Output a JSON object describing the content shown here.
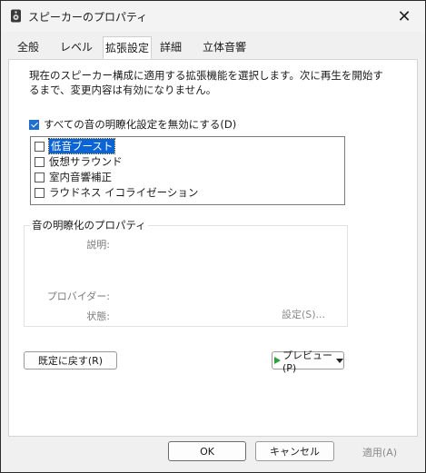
{
  "window": {
    "title": "スピーカーのプロパティ",
    "close_icon": "close-icon"
  },
  "tabs": [
    {
      "label": "全般",
      "active": false
    },
    {
      "label": "レベル",
      "active": false
    },
    {
      "label": "拡張設定",
      "active": true
    },
    {
      "label": "詳細",
      "active": false
    },
    {
      "label": "立体音響",
      "active": false
    }
  ],
  "enhancements": {
    "description": "現在のスピーカー構成に適用する拡張機能を選択します。次に再生を開始するまで、変更内容は有効になりません。",
    "disable_all_label": "すべての音の明瞭化設定を無効にする(D)",
    "disable_all_checked": true,
    "items": [
      {
        "label": "低音ブースト",
        "checked": false,
        "selected": true
      },
      {
        "label": "仮想サラウンド",
        "checked": false,
        "selected": false
      },
      {
        "label": "室内音響補正",
        "checked": false,
        "selected": false
      },
      {
        "label": "ラウドネス イコライゼーション",
        "checked": false,
        "selected": false
      }
    ]
  },
  "properties": {
    "group_title": "音の明瞭化のプロパティ",
    "description_label": "説明:",
    "provider_label": "プロバイダー:",
    "status_label": "状態:",
    "settings_label": "設定(S)..."
  },
  "buttons": {
    "restore_defaults": "既定に戻す(R)",
    "preview": "プレビュー(P)",
    "ok": "OK",
    "cancel": "キャンセル",
    "apply": "適用(A)"
  },
  "colors": {
    "accent": "#1f6fd1",
    "selection": "#0a64d6",
    "play": "#2aa138"
  }
}
